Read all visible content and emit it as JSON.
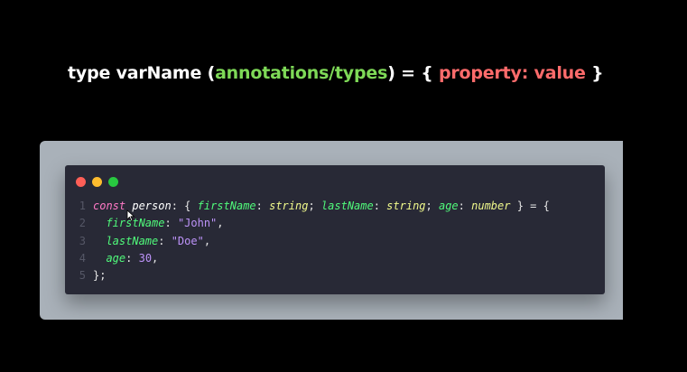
{
  "headline": {
    "part1": "type varName (",
    "part2": "annotations/types",
    "part3": ") = { ",
    "part4": "property: value",
    "part5": " }"
  },
  "colors": {
    "background": "#000000",
    "frame": "#a9b1b9",
    "editor": "#282936",
    "dot_red": "#ff5f57",
    "dot_yellow": "#febc2e",
    "dot_green": "#28c840",
    "accent_green": "#7ed957",
    "accent_red": "#ff6b6b"
  },
  "code": {
    "line_numbers": [
      "1",
      "2",
      "3",
      "4",
      "5"
    ],
    "l1": {
      "kw": "const",
      "space1": " ",
      "var": "person",
      "p1": ": { ",
      "k1": "firstName",
      "p2": ": ",
      "t1": "string",
      "p3": "; ",
      "k2": "lastName",
      "p4": ": ",
      "t2": "string",
      "p5": "; ",
      "k3": "age",
      "p6": ": ",
      "t3": "number",
      "p7": " } = {"
    },
    "l2": {
      "indent": "  ",
      "key": "firstName",
      "sep": ": ",
      "val": "\"John\"",
      "end": ","
    },
    "l3": {
      "indent": "  ",
      "key": "lastName",
      "sep": ": ",
      "val": "\"Doe\"",
      "end": ","
    },
    "l4": {
      "indent": "  ",
      "key": "age",
      "sep": ": ",
      "val": "30",
      "end": ","
    },
    "l5": {
      "close": "};"
    }
  },
  "icons": {
    "window_controls": [
      "close-dot",
      "minimize-dot",
      "maximize-dot"
    ],
    "cursor": "mouse-pointer-icon"
  }
}
